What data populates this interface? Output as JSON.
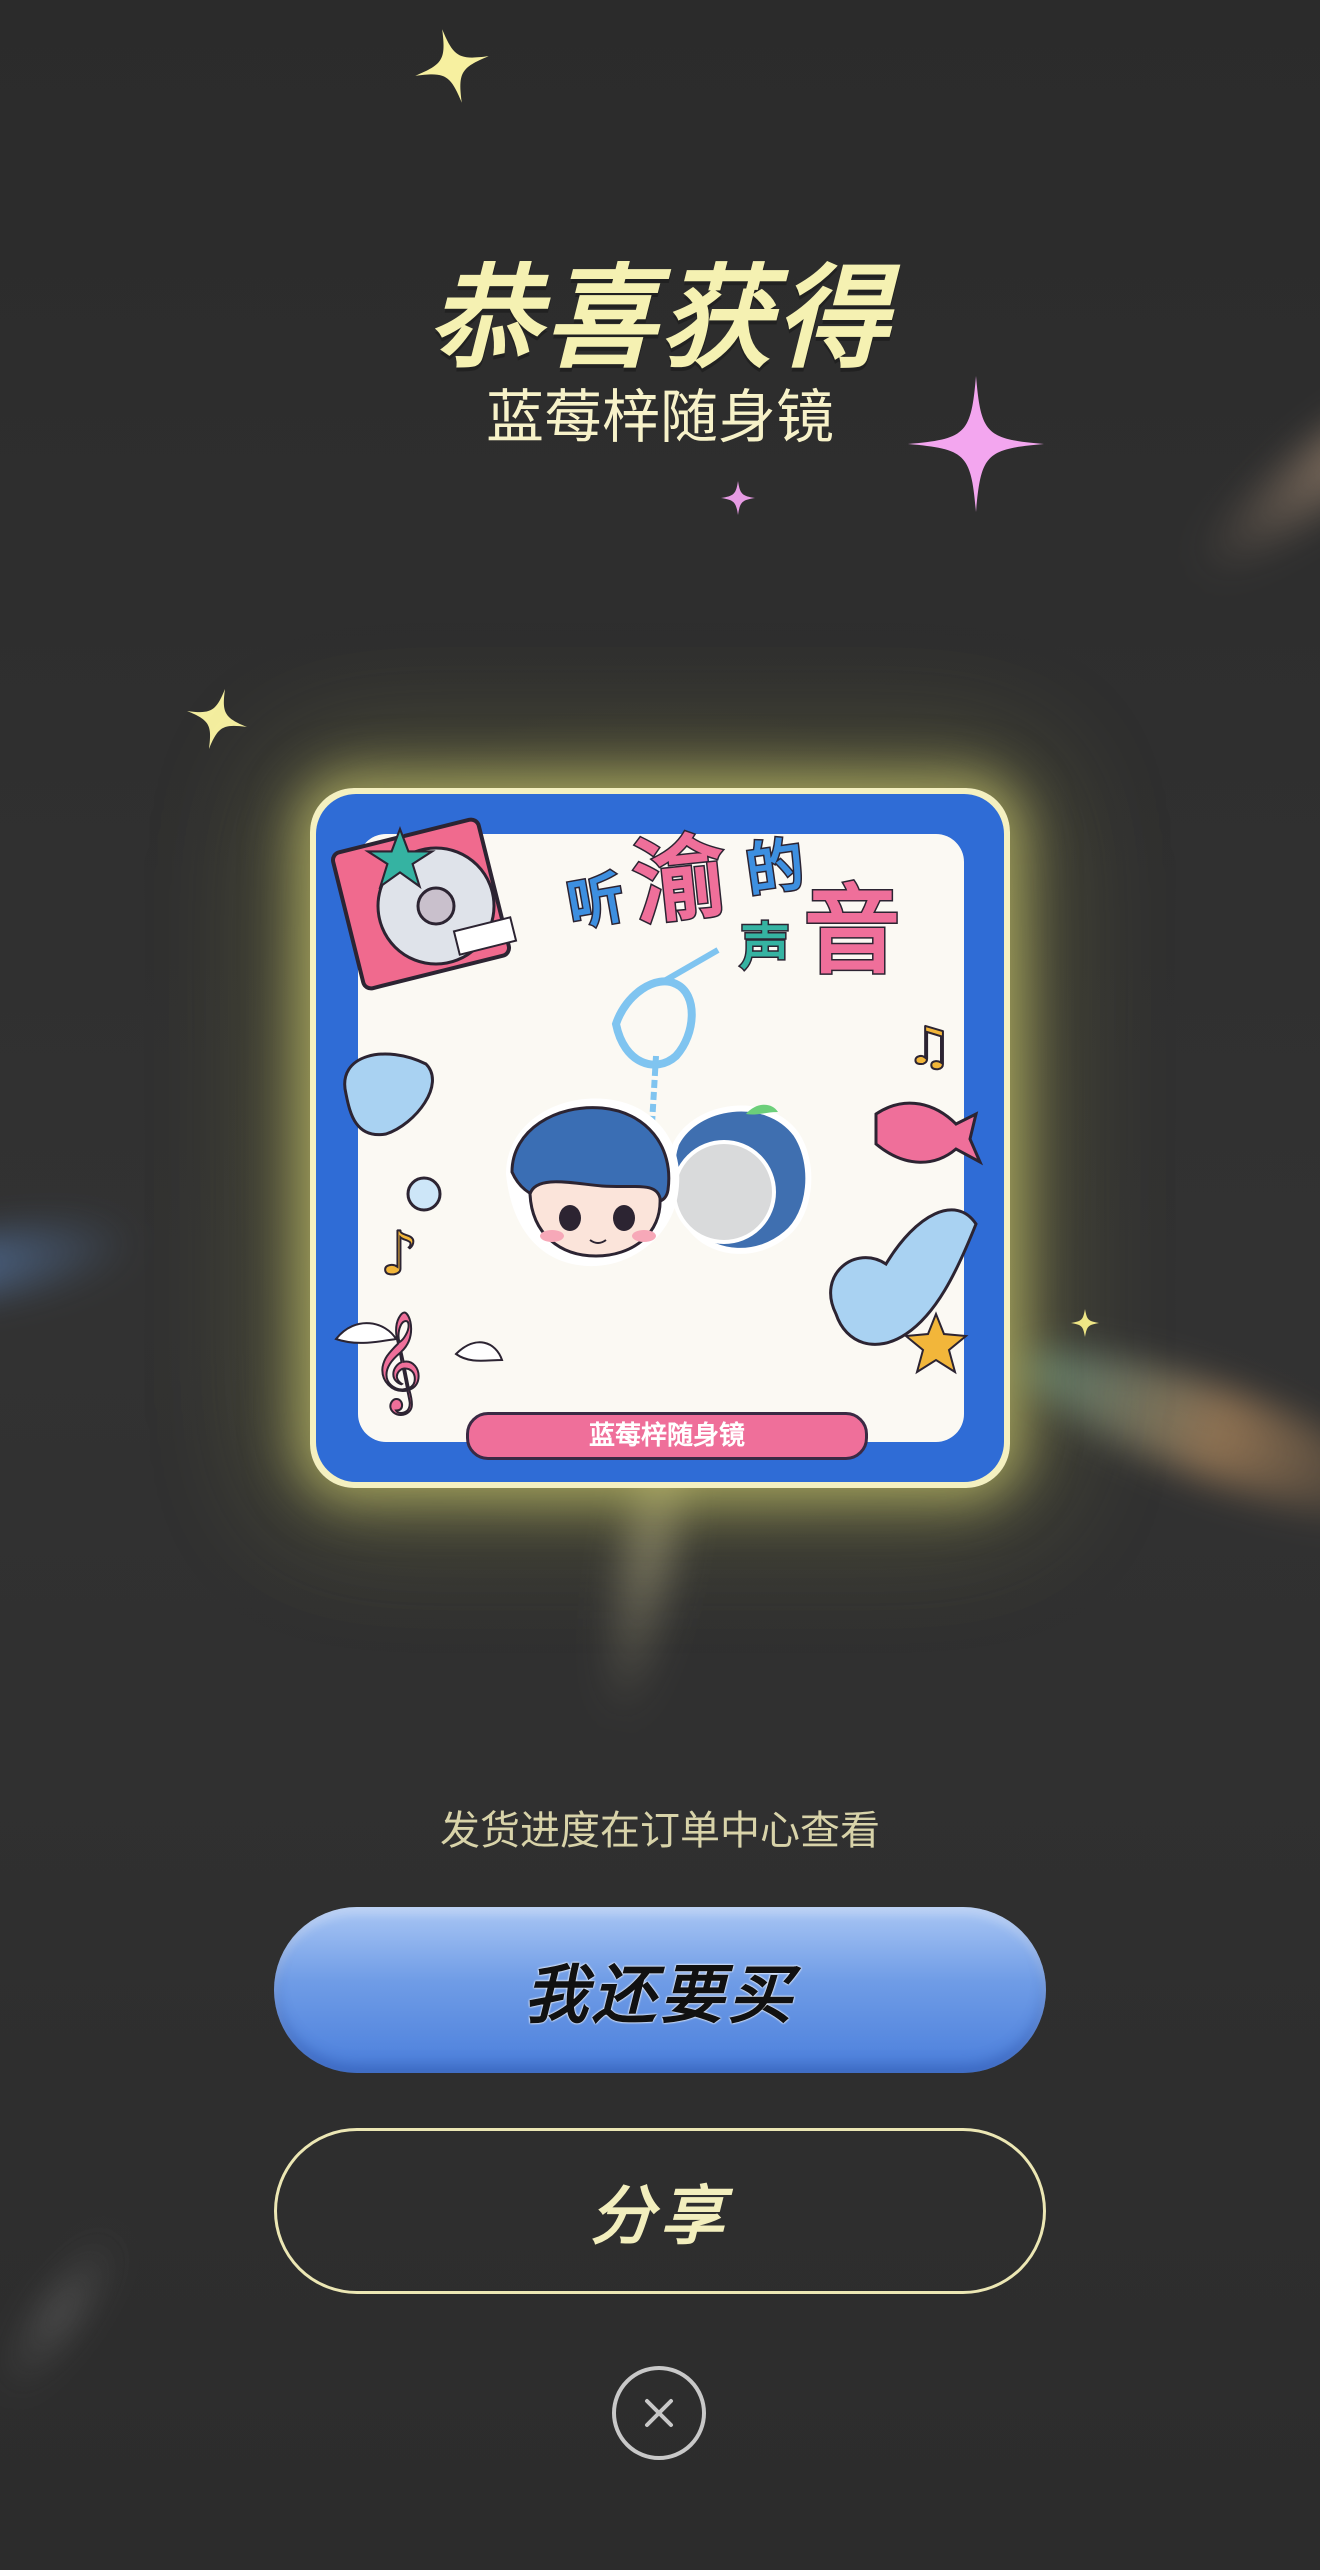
{
  "header": {
    "title": "恭喜获得",
    "prize_name": "蓝莓梓随身镜"
  },
  "card": {
    "banner_text": [
      "听",
      "渝",
      "的",
      "声",
      "音"
    ],
    "product_label": "蓝莓梓随身镜",
    "frame_color": "#2f6cd6",
    "label_color": "#ef6f9a"
  },
  "footer": {
    "hint": "发货进度在订单中心查看",
    "buy_again_label": "我还要买",
    "share_label": "分享",
    "close_icon": "close-icon"
  },
  "colors": {
    "background": "#2e2e2e",
    "title": "#f5f1b2",
    "accent_blue": "#5b8fe3",
    "outline": "#ece7b4"
  }
}
